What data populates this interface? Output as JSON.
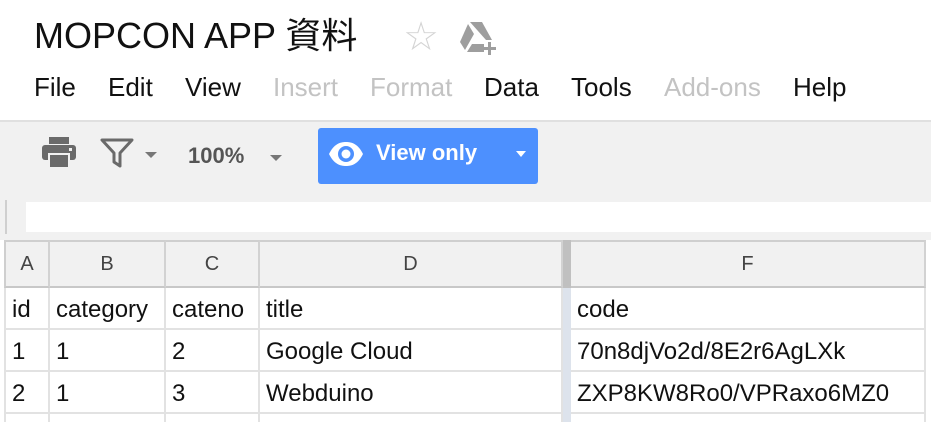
{
  "document": {
    "title": "MOPCON APP 資料"
  },
  "icons": {
    "star": "star-icon",
    "drive": "add-to-drive-icon",
    "print": "print-icon",
    "filter": "filter-icon",
    "eye": "eye-icon"
  },
  "menu": {
    "items": [
      {
        "label": "File",
        "enabled": true
      },
      {
        "label": "Edit",
        "enabled": true
      },
      {
        "label": "View",
        "enabled": true
      },
      {
        "label": "Insert",
        "enabled": false
      },
      {
        "label": "Format",
        "enabled": false
      },
      {
        "label": "Data",
        "enabled": true
      },
      {
        "label": "Tools",
        "enabled": true
      },
      {
        "label": "Add-ons",
        "enabled": false
      },
      {
        "label": "Help",
        "enabled": true
      }
    ]
  },
  "toolbar": {
    "zoom": "100%",
    "view_mode_label": "View only"
  },
  "colors": {
    "accent": "#4d90fe",
    "disabled_text": "#c3c3c3",
    "toolbar_bg": "#f1f1f1"
  },
  "formula_bar": {
    "value": ""
  },
  "grid": {
    "columns": [
      "A",
      "B",
      "C",
      "D",
      "F"
    ],
    "rows": [
      [
        "id",
        "category",
        "cateno",
        "title",
        "code"
      ],
      [
        "1",
        "1",
        "2",
        "Google Cloud",
        "70n8djVo2d/8E2r6AgLXk"
      ],
      [
        "2",
        "1",
        "3",
        "Webduino",
        "ZXP8KW8Ro0/VPRaxo6MZ0"
      ]
    ]
  }
}
